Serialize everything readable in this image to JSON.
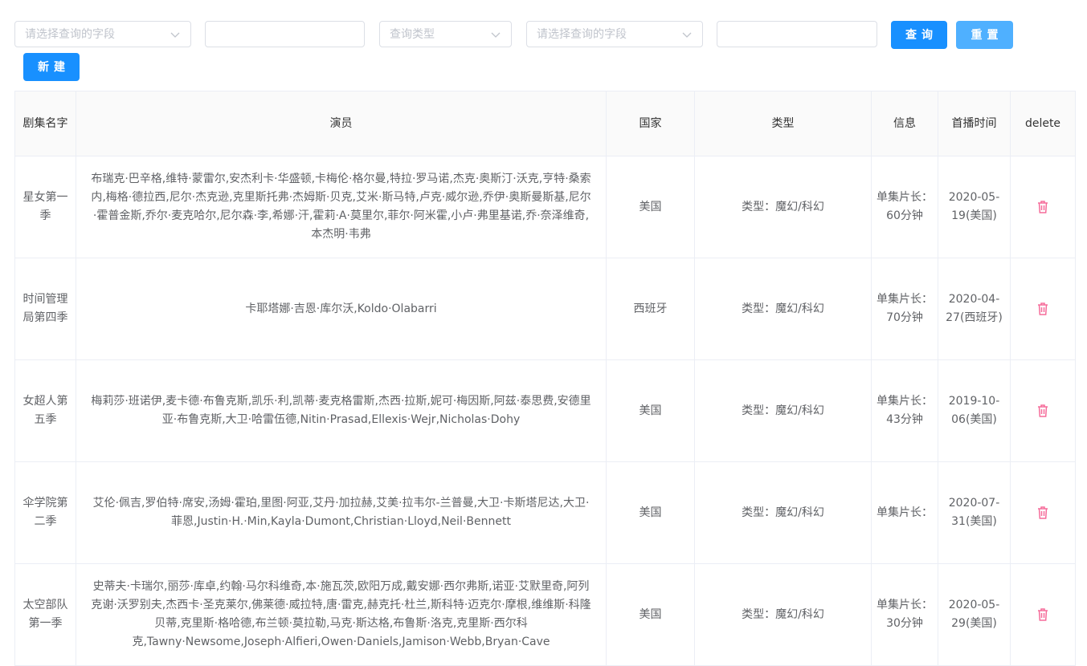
{
  "filters": {
    "field1_placeholder": "请选择查询的字段",
    "input1_value": "",
    "type_placeholder": "查询类型",
    "field2_placeholder": "请选择查询的字段",
    "input2_value": "",
    "query_label": "查询",
    "reset_label": "重置",
    "new_label": "新建"
  },
  "table": {
    "headers": [
      "剧集名字",
      "演员",
      "国家",
      "类型",
      "信息",
      "首播时间",
      "delete"
    ],
    "rows": [
      {
        "name": "星女第一季",
        "actors": "布瑞克·巴辛格,维特·蒙雷尔,安杰利卡·华盛顿,卡梅伦·格尔曼,特拉·罗马诺,杰克·奥斯汀·沃克,亨特·桑索内,梅格·德拉西,尼尔·杰克逊,克里斯托弗·杰姆斯·贝克,艾米·斯马特,卢克·威尔逊,乔伊·奥斯曼斯基,尼尔·霍普金斯,乔尔·麦克哈尔,尼尔森·李,希娜·汗,霍莉·A·莫里尔,菲尔·阿米霍,小卢·弗里基诺,乔·奈泽维奇,本杰明·韦弗",
        "country": "美国",
        "type": "类型：魔幻/科幻",
        "info": "单集片长：60分钟",
        "premiere": "2020-05-19(美国)"
      },
      {
        "name": "时间管理局第四季",
        "actors": "卡耶塔娜·吉恩·库尔沃,Koldo·Olabarri",
        "country": "西班牙",
        "type": "类型：魔幻/科幻",
        "info": "单集片长：70分钟",
        "premiere": "2020-04-27(西班牙)"
      },
      {
        "name": "女超人第五季",
        "actors": "梅莉莎·班诺伊,麦卡德·布鲁克斯,凯乐·利,凯蒂·麦克格雷斯,杰西·拉斯,妮可·梅因斯,阿兹·泰思费,安德里亚·布鲁克斯,大卫·哈雷伍德,Nitin·Prasad,Ellexis·Wejr,Nicholas·Dohy",
        "country": "美国",
        "type": "类型：魔幻/科幻",
        "info": "单集片长：43分钟",
        "premiere": "2019-10-06(美国)"
      },
      {
        "name": "伞学院第二季",
        "actors": "艾伦·佩吉,罗伯特·席安,汤姆·霍珀,里图·阿亚,艾丹·加拉赫,艾美·拉韦尔-兰普曼,大卫·卡斯塔尼达,大卫·菲恩,Justin·H.·Min,Kayla·Dumont,Christian·Lloyd,Neil·Bennett",
        "country": "美国",
        "type": "类型：魔幻/科幻",
        "info": "单集片长：",
        "premiere": "2020-07-31(美国)"
      },
      {
        "name": "太空部队第一季",
        "actors": "史蒂夫·卡瑞尔,丽莎·库卓,约翰·马尔科维奇,本·施瓦茨,欧阳万成,戴安娜·西尔弗斯,诺亚·艾默里奇,阿列克谢·沃罗别夫,杰西卡·圣克莱尔,佛莱德·威拉特,唐·雷克,赫克托·杜兰,斯科特·迈克尔·摩根,维维斯·科隆贝蒂,克里斯·格哈德,布兰顿·莫拉勒,马克·斯达格,布鲁斯·洛克,克里斯·西尔科克,Tawny·Newsome,Joseph·Alfieri,Owen·Daniels,Jamison·Webb,Bryan·Cave",
        "country": "美国",
        "type": "类型：魔幻/科幻",
        "info": "单集片长：30分钟",
        "premiere": "2020-05-29(美国)"
      }
    ]
  },
  "icons": {
    "delete": "trash-icon",
    "dropdown": "chevron-down-icon"
  },
  "colors": {
    "primary": "#1890ff",
    "primary_light": "#4fb0ff",
    "danger": "#f56c9a",
    "border": "#ebeef5"
  }
}
